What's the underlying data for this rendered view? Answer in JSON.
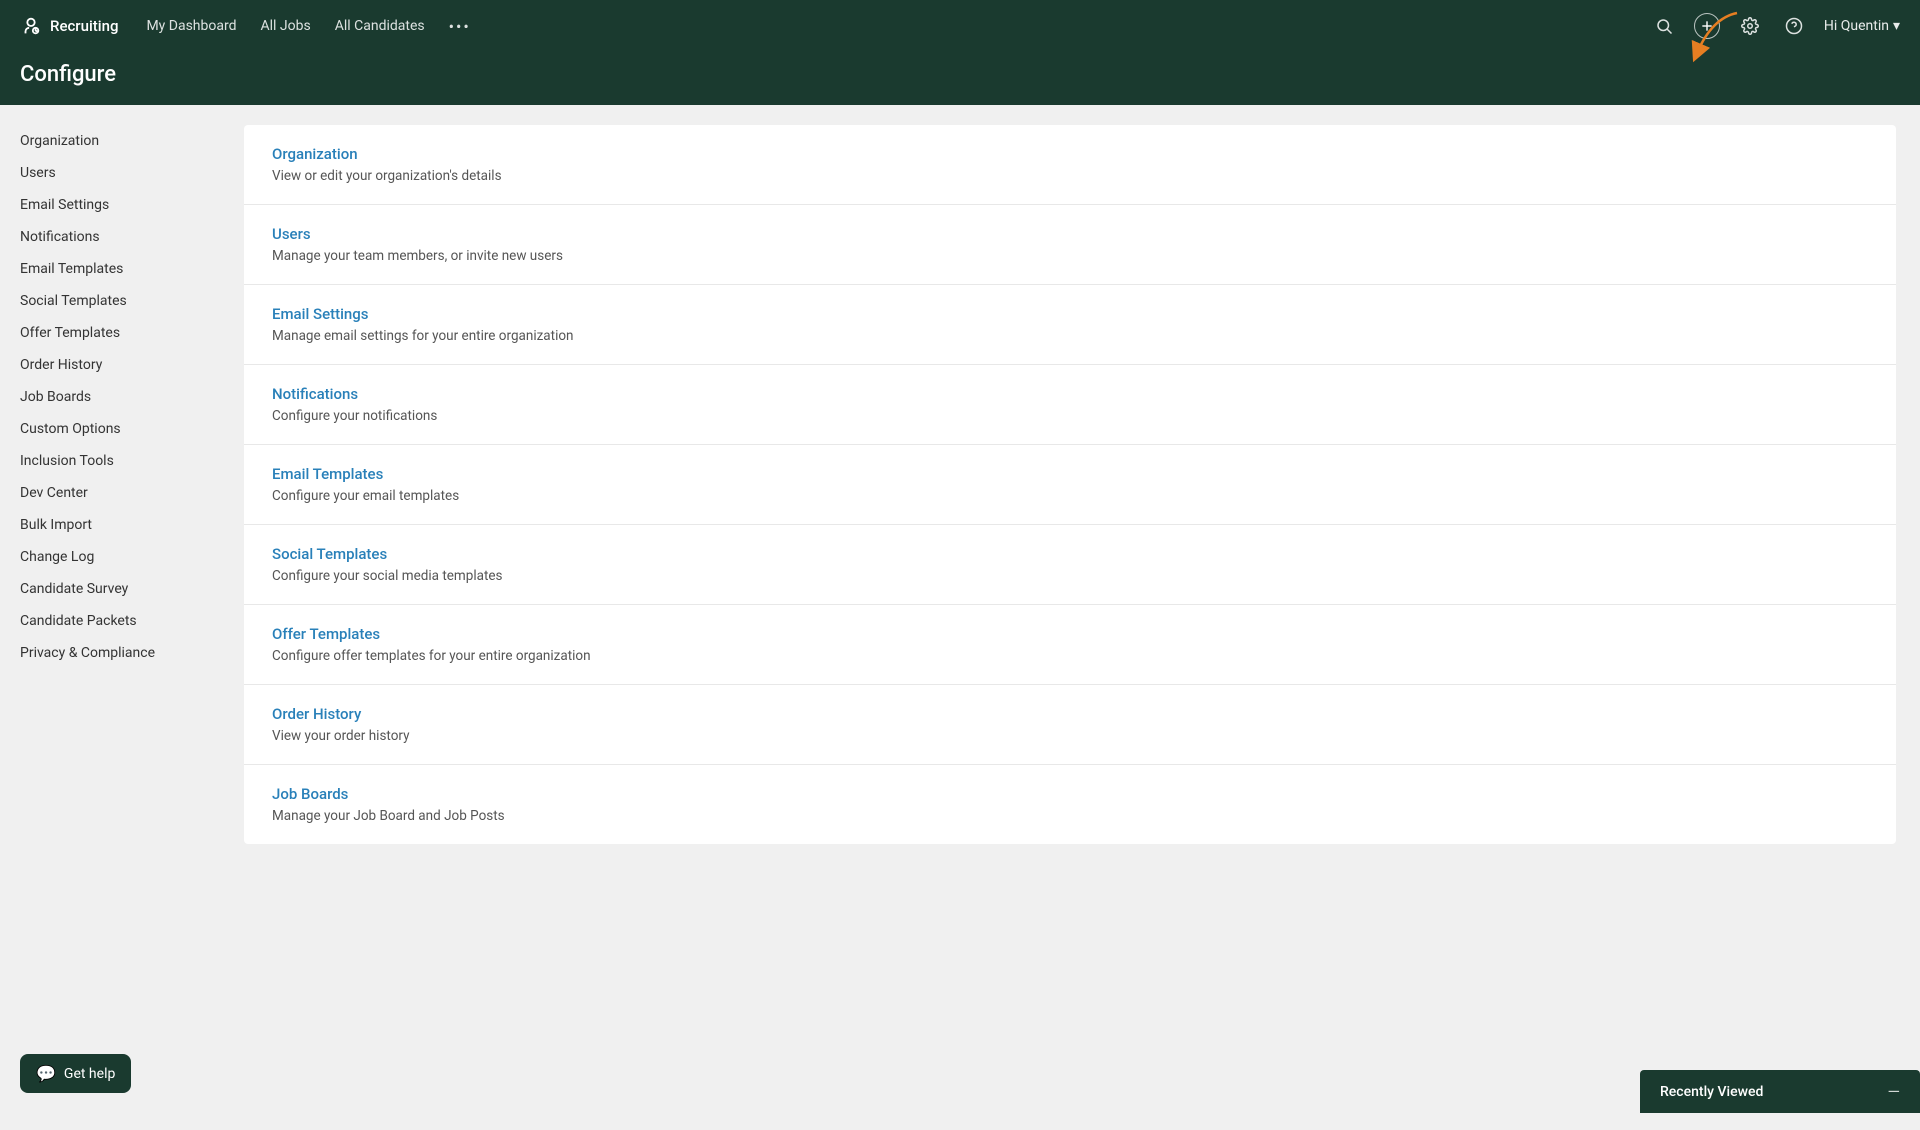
{
  "nav": {
    "logo_text": "Recruiting",
    "links": [
      {
        "label": "My Dashboard",
        "id": "my-dashboard"
      },
      {
        "label": "All Jobs",
        "id": "all-jobs"
      },
      {
        "label": "All Candidates",
        "id": "all-candidates"
      }
    ],
    "more_label": "•••",
    "user_label": "Hi Quentin",
    "user_chevron": "▾"
  },
  "page": {
    "title": "Configure"
  },
  "sidebar": {
    "items": [
      {
        "label": "Organization",
        "id": "org"
      },
      {
        "label": "Users",
        "id": "users"
      },
      {
        "label": "Email Settings",
        "id": "email-settings"
      },
      {
        "label": "Notifications",
        "id": "notifications"
      },
      {
        "label": "Email Templates",
        "id": "email-templates"
      },
      {
        "label": "Social Templates",
        "id": "social-templates"
      },
      {
        "label": "Offer Templates",
        "id": "offer-templates"
      },
      {
        "label": "Order History",
        "id": "order-history"
      },
      {
        "label": "Job Boards",
        "id": "job-boards"
      },
      {
        "label": "Custom Options",
        "id": "custom-options"
      },
      {
        "label": "Inclusion Tools",
        "id": "inclusion-tools"
      },
      {
        "label": "Dev Center",
        "id": "dev-center"
      },
      {
        "label": "Bulk Import",
        "id": "bulk-import"
      },
      {
        "label": "Change Log",
        "id": "change-log"
      },
      {
        "label": "Candidate Survey",
        "id": "candidate-survey"
      },
      {
        "label": "Candidate Packets",
        "id": "candidate-packets"
      },
      {
        "label": "Privacy & Compliance",
        "id": "privacy-compliance"
      }
    ]
  },
  "content": {
    "items": [
      {
        "title": "Organization",
        "desc": "View or edit your organization's details"
      },
      {
        "title": "Users",
        "desc": "Manage your team members, or invite new users"
      },
      {
        "title": "Email Settings",
        "desc": "Manage email settings for your entire organization"
      },
      {
        "title": "Notifications",
        "desc": "Configure your notifications"
      },
      {
        "title": "Email Templates",
        "desc": "Configure your email templates"
      },
      {
        "title": "Social Templates",
        "desc": "Configure your social media templates"
      },
      {
        "title": "Offer Templates",
        "desc": "Configure offer templates for your entire organization"
      },
      {
        "title": "Order History",
        "desc": "View your order history"
      },
      {
        "title": "Job Boards",
        "desc": "Manage your Job Board and Job Posts"
      }
    ]
  },
  "chat": {
    "label": "Get help"
  },
  "recently_viewed": {
    "label": "Recently Viewed",
    "minimize_symbol": "—"
  }
}
